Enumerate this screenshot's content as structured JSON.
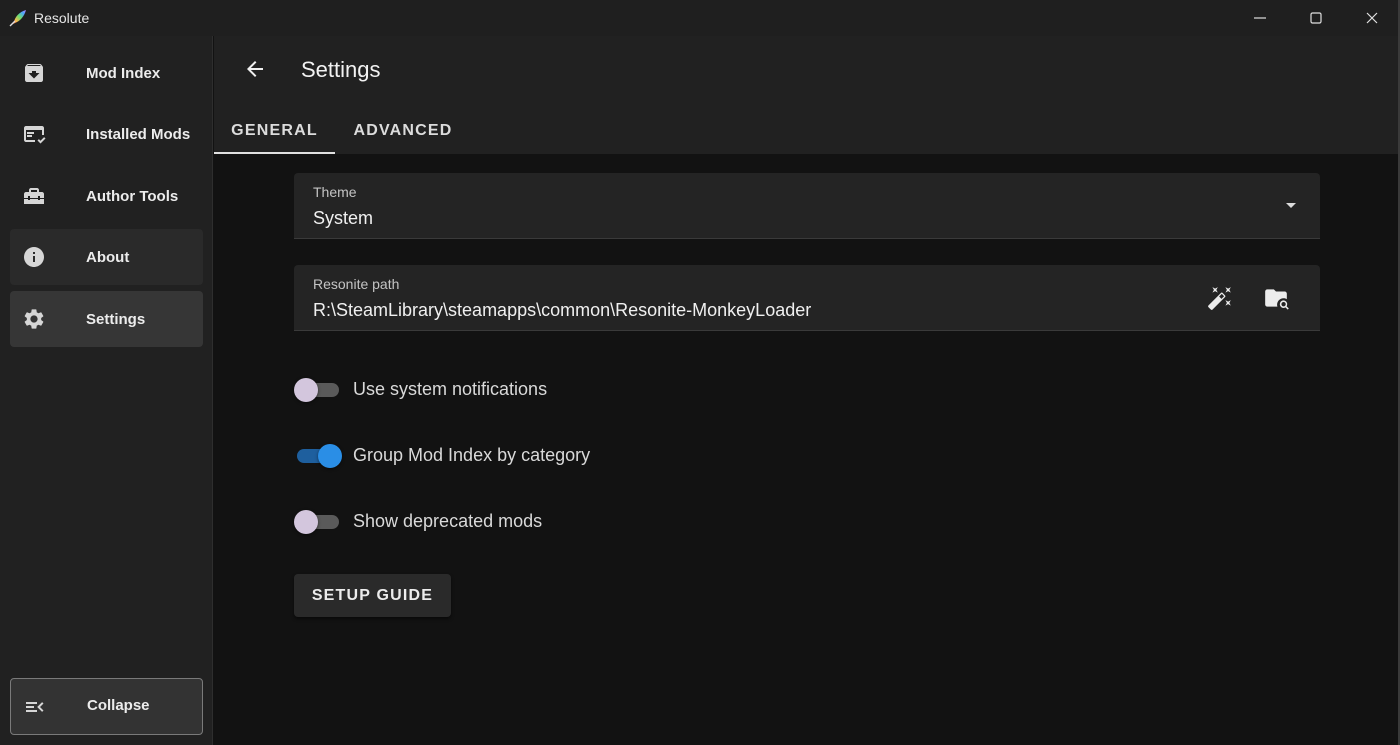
{
  "window": {
    "title": "Resolute",
    "logo_icon": "feather-rainbow-icon",
    "controls": [
      "minimize-icon",
      "maximize-icon",
      "close-icon"
    ]
  },
  "sidebar": {
    "items": [
      {
        "label": "Mod Index",
        "icon": "archive-download-icon",
        "state": "normal"
      },
      {
        "label": "Installed Mods",
        "icon": "list-check-icon",
        "state": "normal"
      },
      {
        "label": "Author Tools",
        "icon": "toolbox-icon",
        "state": "normal"
      },
      {
        "label": "About",
        "icon": "info-icon",
        "state": "hover"
      },
      {
        "label": "Settings",
        "icon": "gear-icon",
        "state": "active"
      }
    ],
    "collapse_label": "Collapse",
    "collapse_icon": "menu-collapse-icon"
  },
  "header": {
    "title": "Settings",
    "back_icon": "arrow-left-icon",
    "tabs": [
      {
        "label": "GENERAL",
        "active": true
      },
      {
        "label": "ADVANCED",
        "active": false
      }
    ]
  },
  "settings": {
    "theme": {
      "label": "Theme",
      "value": "System"
    },
    "resonite_path": {
      "label": "Resonite path",
      "value": "R:\\SteamLibrary\\steamapps\\common\\Resonite-MonkeyLoader",
      "actions": [
        "magic-wand-icon",
        "folder-search-icon"
      ]
    },
    "toggles": [
      {
        "label": "Use system notifications",
        "on": false
      },
      {
        "label": "Group Mod Index by category",
        "on": true
      },
      {
        "label": "Show deprecated mods",
        "on": false
      }
    ],
    "setup_button_label": "SETUP GUIDE"
  },
  "colors": {
    "accent": "#2a8ee6",
    "toggle_off_thumb": "#d3c6dd",
    "background": "#121212",
    "surface": "#212121"
  }
}
